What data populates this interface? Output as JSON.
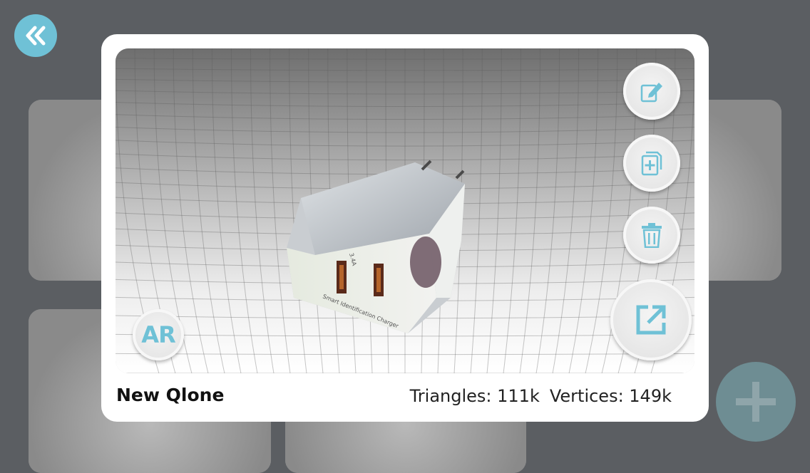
{
  "scan": {
    "title": "New Qlone",
    "triangles_label": "Triangles: 111k",
    "vertices_label": "Vertices: 149k",
    "model_text": {
      "rating": "3.4A",
      "caption": "Smart Identification Charger"
    }
  },
  "buttons": {
    "ar_label": "AR",
    "back_icon": "double-chevron-left-icon",
    "edit_icon": "edit-icon",
    "duplicate_icon": "duplicate-icon",
    "delete_icon": "trash-icon",
    "share_icon": "share-icon",
    "add_icon": "plus-icon"
  },
  "colors": {
    "accent": "#6fc1d6",
    "backdrop": "#5b5e62",
    "fab": "#6e8d93"
  }
}
